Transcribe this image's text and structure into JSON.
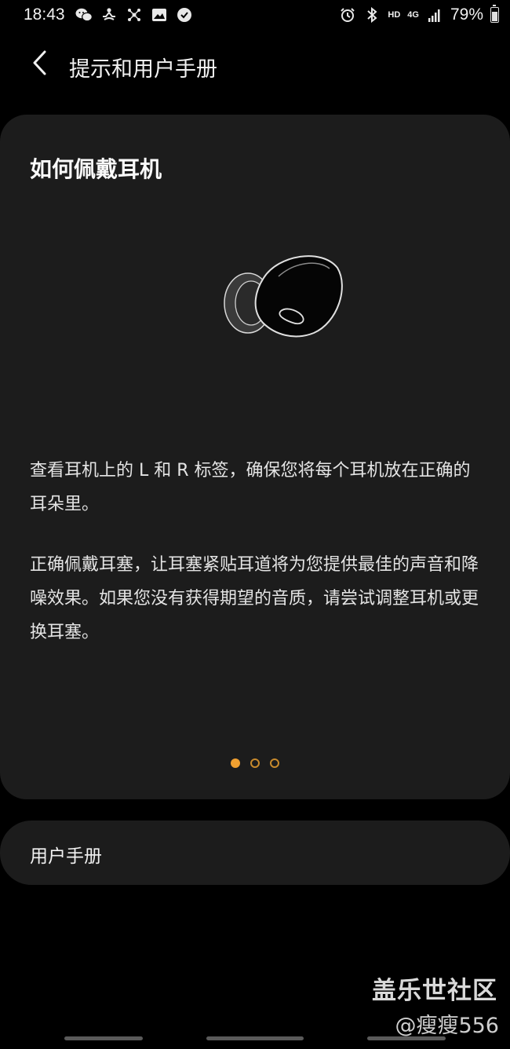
{
  "status_bar": {
    "time": "18:43",
    "left_icons": [
      "wechat-icon",
      "meditation-icon",
      "network-icon",
      "gallery-icon",
      "check-badge-icon"
    ],
    "right_icons": [
      "alarm-icon",
      "bluetooth-icon"
    ],
    "hd_label": "HD",
    "network_label": "4G",
    "battery_percent": "79%",
    "battery_level": 0.79
  },
  "header": {
    "back_icon": "chevron-left-icon",
    "title": "提示和用户手册"
  },
  "tip_card": {
    "heading": "如何佩戴耳机",
    "illustration": "earbud-illustration",
    "paragraph_1": "查看耳机上的 L 和 R 标签，确保您将每个耳机放在正确的耳朵里。",
    "paragraph_2": "正确佩戴耳塞，让耳塞紧贴耳道将为您提供最佳的声音和降噪效果。如果您没有获得期望的音质，请尝试调整耳机或更换耳塞。",
    "pages": {
      "total": 3,
      "current": 1
    },
    "accent_color": "#f0a030",
    "background_color": "#1c1c1c"
  },
  "manual_row": {
    "label": "用户手册"
  },
  "watermark": {
    "title": "盖乐世社区",
    "user": "@瘦瘦556"
  }
}
